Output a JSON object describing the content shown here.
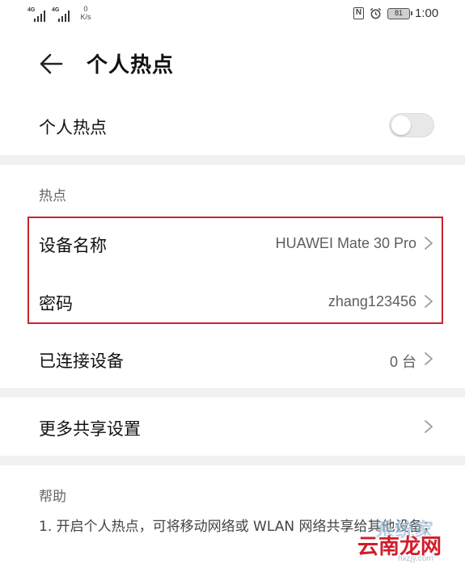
{
  "status_bar": {
    "signal1_label": "4G",
    "signal2_label": "4G",
    "net_speed_value": "0",
    "net_speed_unit": "K/s",
    "nfc_label": "N",
    "battery_level": "81",
    "time": "1:00"
  },
  "header": {
    "title": "个人热点"
  },
  "hotspot_toggle": {
    "label": "个人热点",
    "enabled": false
  },
  "hotspot_section": {
    "header": "热点",
    "device_name_label": "设备名称",
    "device_name_value": "HUAWEI Mate 30 Pro",
    "password_label": "密码",
    "password_value": "zhang123456",
    "connected_label": "已连接设备",
    "connected_value": "0 台"
  },
  "more_sharing": {
    "label": "更多共享设置"
  },
  "help": {
    "header": "帮助",
    "text": "1. 开启个人热点，可将移动网络或 WLAN 网络共享给其他设备；"
  },
  "watermark": {
    "main": "云南龙网",
    "faint": "系统家",
    "url": "hxzjy.com"
  },
  "colors": {
    "highlight": "#c8252c",
    "watermark": "#d11d2a",
    "divider": "#f1f1f1"
  }
}
